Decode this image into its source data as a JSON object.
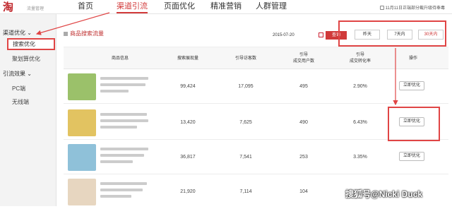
{
  "header": {
    "logo_text": "流量管理",
    "tabs": [
      {
        "label": "首页"
      },
      {
        "label": "渠道引流"
      },
      {
        "label": "页面优化"
      },
      {
        "label": "精准营销"
      },
      {
        "label": "人群管理"
      }
    ],
    "notice": "11月11日正端部分截升级待奉毒"
  },
  "sidebar": {
    "group1": "渠道优化",
    "items1": [
      {
        "label": "搜索优化"
      },
      {
        "label": "聚划算优化"
      }
    ],
    "group2": "引流效果",
    "items2": [
      {
        "label": "PC端"
      },
      {
        "label": "无线端"
      }
    ]
  },
  "main": {
    "section_title": "商品搜索流量",
    "date": "2015-07-20",
    "query_label": "查询",
    "ranges": [
      {
        "label": "昨天"
      },
      {
        "label": "7天内"
      },
      {
        "label": "30天内"
      }
    ]
  },
  "table": {
    "headers": {
      "product": "商品信息",
      "impressions": "搜索展现量",
      "visitors": "引导访客数",
      "buyers_l1": "引导",
      "buyers_l2": "成交用户数",
      "conv_l1": "引导",
      "conv_l2": "成交转化率",
      "action": "操作"
    },
    "rows": [
      {
        "impressions": "99,424",
        "visitors": "17,095",
        "buyers": "495",
        "conv": "2.90%",
        "action": "立即优化",
        "thumb_color": "#9bc16a"
      },
      {
        "impressions": "13,420",
        "visitors": "7,625",
        "buyers": "490",
        "conv": "6.43%",
        "action": "立即优化",
        "thumb_color": "#e2c361"
      },
      {
        "impressions": "36,817",
        "visitors": "7,541",
        "buyers": "253",
        "conv": "3.35%",
        "action": "立即优化",
        "thumb_color": "#8fc1d9"
      },
      {
        "impressions": "21,920",
        "visitors": "7,114",
        "buyers": "104",
        "conv": "",
        "action": "",
        "thumb_color": "#e7d6c0"
      }
    ]
  },
  "watermark": "搜狐号@Nicki Duck",
  "colors": {
    "accent": "#d23a3a",
    "highlight": "#e04545"
  }
}
